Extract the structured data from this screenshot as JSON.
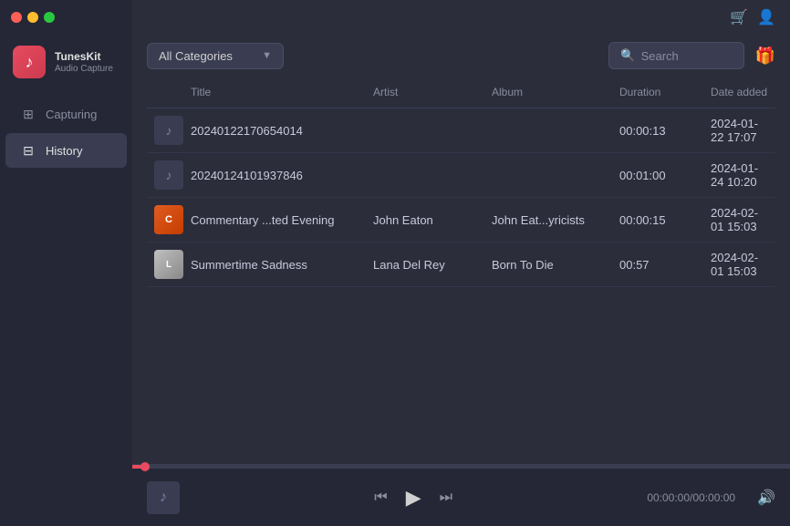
{
  "app": {
    "name": "TunesKit",
    "subtitle": "Audio Capture",
    "icon": "♪"
  },
  "topbar": {
    "cart_icon": "🛒",
    "user_icon": "👤"
  },
  "toolbar": {
    "category_label": "All Categories",
    "search_placeholder": "Search",
    "gift_icon": "🎁"
  },
  "sidebar": {
    "items": [
      {
        "id": "capturing",
        "label": "Capturing",
        "icon": "⊞"
      },
      {
        "id": "history",
        "label": "History",
        "icon": "⊟",
        "active": true
      }
    ]
  },
  "table": {
    "columns": [
      "",
      "Title",
      "Artist",
      "Album",
      "Duration",
      "Date added"
    ],
    "rows": [
      {
        "id": 1,
        "thumb_type": "music-note",
        "title": "20240122170654014",
        "artist": "",
        "album": "",
        "duration": "00:00:13",
        "date_added": "2024-01-22 17:07"
      },
      {
        "id": 2,
        "thumb_type": "music-note",
        "title": "20240124101937846",
        "artist": "",
        "album": "",
        "duration": "00:01:00",
        "date_added": "2024-01-24 10:20"
      },
      {
        "id": 3,
        "thumb_type": "commentary",
        "thumb_text": "C",
        "title": "Commentary ...ted Evening",
        "artist": "John Eaton",
        "album": "John Eat...yricists",
        "duration": "00:00:15",
        "date_added": "2024-02-01 15:03"
      },
      {
        "id": 4,
        "thumb_type": "lana",
        "thumb_text": "L",
        "title": "Summertime Sadness",
        "artist": "Lana Del Rey",
        "album": "Born To Die",
        "duration": "00:57",
        "date_added": "2024-02-01 15:03"
      }
    ]
  },
  "player": {
    "time_current": "00:00:00",
    "time_total": "00:00:00",
    "time_display": "00:00:00/00:00:00",
    "progress_percent": 2
  }
}
